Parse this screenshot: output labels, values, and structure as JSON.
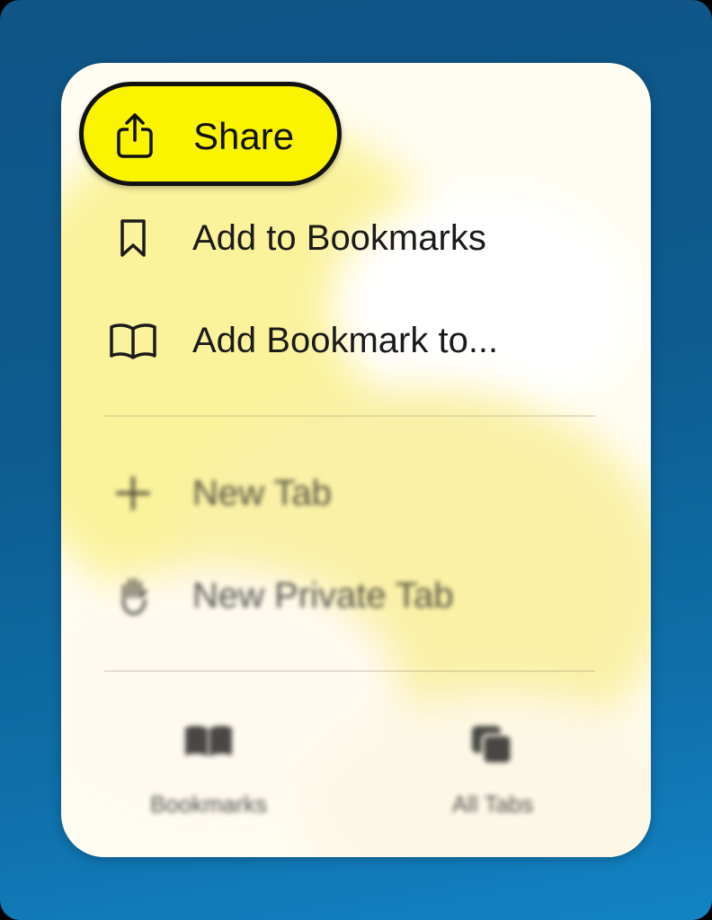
{
  "menu": {
    "share_label": "Share",
    "items": [
      {
        "label": "Add to Bookmarks",
        "icon": "bookmark-icon"
      },
      {
        "label": "Add Bookmark to...",
        "icon": "open-book-icon"
      },
      {
        "label": "New Tab",
        "icon": "plus-icon"
      },
      {
        "label": "New Private Tab",
        "icon": "hand-icon"
      }
    ],
    "share_icon": "share-icon"
  },
  "bottom_bar": {
    "bookmarks_label": "Bookmarks",
    "all_tabs_label": "All Tabs"
  },
  "colors": {
    "highlight": "#fbf400",
    "background_blue": "#0f6ea8"
  }
}
